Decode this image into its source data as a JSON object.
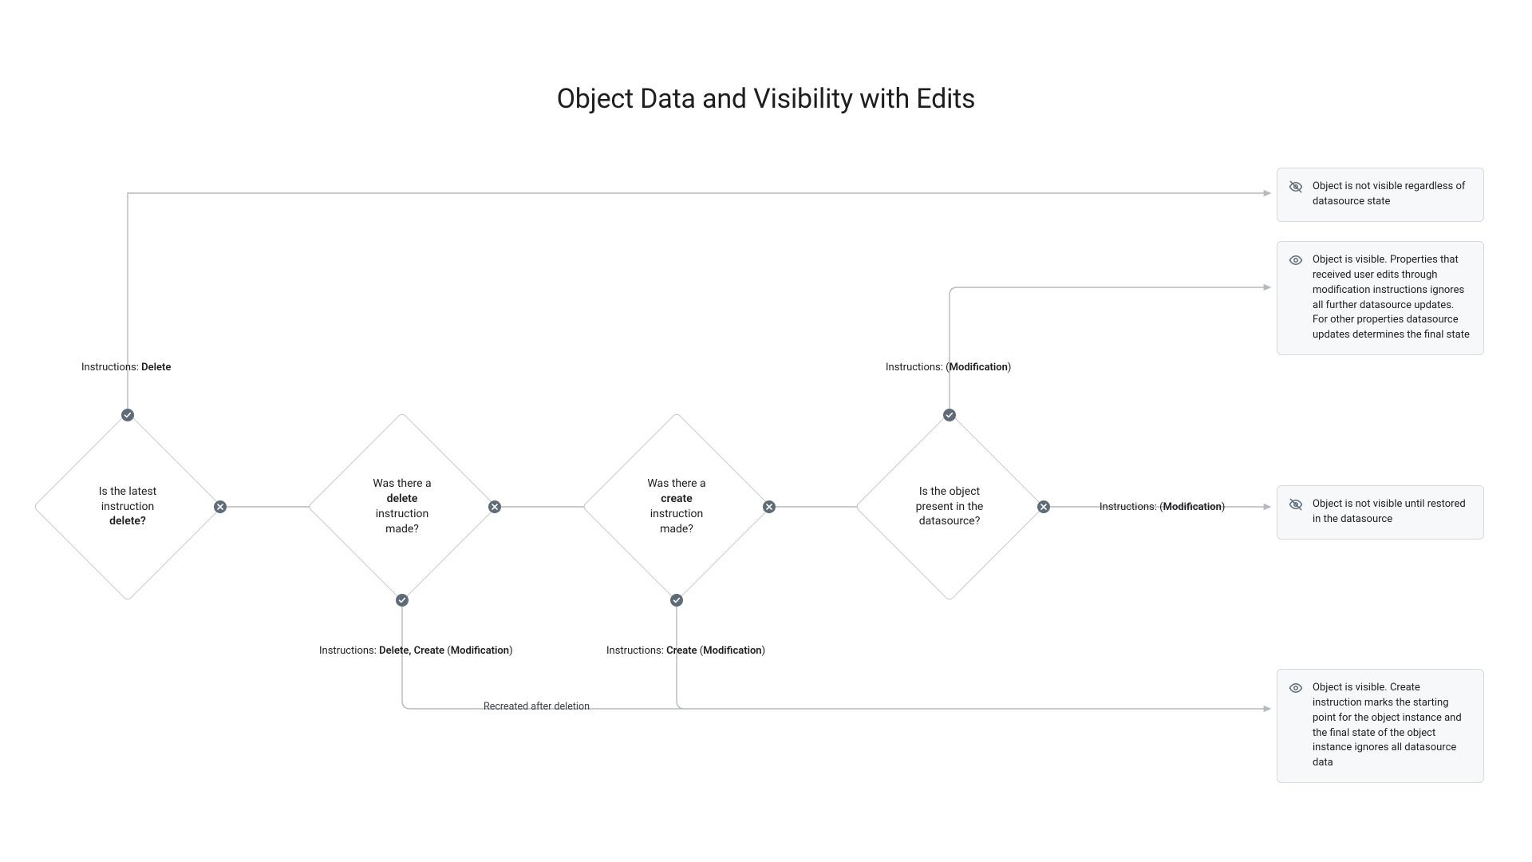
{
  "title": "Object Data and Visibility with Edits",
  "diamonds": {
    "d1": {
      "line1": "Is the latest",
      "line2": "instruction",
      "bold": "delete?"
    },
    "d2": {
      "line1": "Was there a",
      "bold": "delete",
      "line2": "instruction",
      "line3": "made?"
    },
    "d3": {
      "line1": "Was there a",
      "bold": "create",
      "line2": "instruction",
      "line3": "made?"
    },
    "d4": {
      "line1": "Is the object",
      "line2": "present in the",
      "line3": "datasource?"
    }
  },
  "labels": {
    "l_delete": {
      "pre": "Instructions: ",
      "bold": "Delete"
    },
    "l_mod_top": {
      "pre": "Instructions: (",
      "bold": "Modification",
      "post": ")"
    },
    "l_mod_right": {
      "pre": "Instructions: (",
      "bold": "Modification",
      "post": ")"
    },
    "l_del_create": {
      "pre": "Instructions: ",
      "bold": "Delete, Create",
      "post": " (",
      "bold2": "Modification",
      "post2": ")"
    },
    "l_create": {
      "pre": "Instructions: ",
      "bold": "Create",
      "post": "  (",
      "bold2": "Modification",
      "post2": ")"
    },
    "l_recreated": "Recreated after deletion"
  },
  "cards": {
    "c1": "Object is not visible regardless of datasource state",
    "c2": "Object is visible. Properties that received user edits through modification instructions ignores all further datasource updates. For other properties datasource updates determines the final state",
    "c3": "Object is not visible until restored in the datasource",
    "c4": "Object is visible. Create instruction marks the starting point for the object instance and the final state of the object instance ignores all datasource data"
  }
}
